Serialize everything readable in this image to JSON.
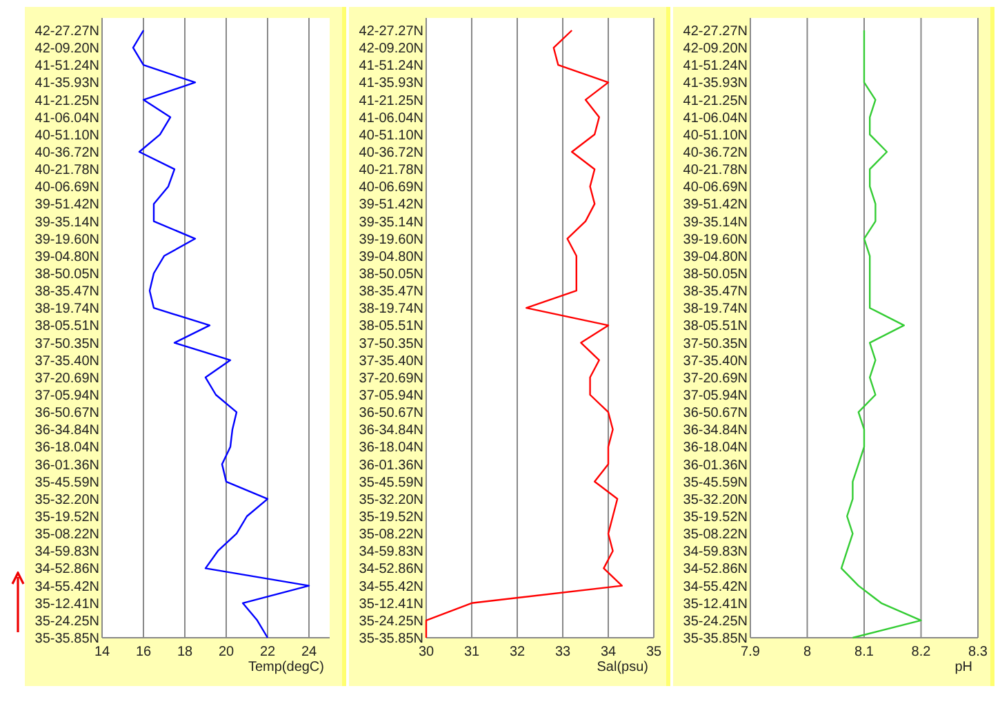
{
  "charts": [
    {
      "chart_data": {
        "type": "line",
        "orientation": "horizontal",
        "xlabel": "Temp(degC)",
        "categories": [
          "42-27.27N",
          "42-09.20N",
          "41-51.24N",
          "41-35.93N",
          "41-21.25N",
          "41-06.04N",
          "40-51.10N",
          "40-36.72N",
          "40-21.78N",
          "40-06.69N",
          "39-51.42N",
          "39-35.14N",
          "39-19.60N",
          "39-04.80N",
          "38-50.05N",
          "38-35.47N",
          "38-19.74N",
          "38-05.51N",
          "37-50.35N",
          "37-35.40N",
          "37-20.69N",
          "37-05.94N",
          "36-50.67N",
          "36-34.84N",
          "36-18.04N",
          "36-01.36N",
          "35-45.59N",
          "35-32.20N",
          "35-19.52N",
          "35-08.22N",
          "34-59.83N",
          "34-52.86N",
          "34-55.42N",
          "35-12.41N",
          "35-24.25N",
          "35-35.85N"
        ],
        "xlim": [
          14,
          25
        ],
        "xticks": [
          14,
          16,
          18,
          20,
          22,
          24
        ],
        "grid": true,
        "series": [
          {
            "color": "#0000ff",
            "values": [
              16,
              15.5,
              16,
              18.5,
              16,
              17.3,
              16.8,
              15.8,
              17.5,
              17.2,
              16.5,
              16.5,
              18.5,
              17,
              16.5,
              16.3,
              16.5,
              19.2,
              17.5,
              20.2,
              19,
              19.5,
              20.5,
              20.3,
              20.2,
              19.8,
              20,
              22,
              21,
              20.5,
              19.6,
              19,
              24,
              20.8,
              21.5,
              22
            ]
          }
        ]
      }
    },
    {
      "chart_data": {
        "type": "line",
        "orientation": "horizontal",
        "xlabel": "Sal(psu)",
        "categories": [
          "42-27.27N",
          "42-09.20N",
          "41-51.24N",
          "41-35.93N",
          "41-21.25N",
          "41-06.04N",
          "40-51.10N",
          "40-36.72N",
          "40-21.78N",
          "40-06.69N",
          "39-51.42N",
          "39-35.14N",
          "39-19.60N",
          "39-04.80N",
          "38-50.05N",
          "38-35.47N",
          "38-19.74N",
          "38-05.51N",
          "37-50.35N",
          "37-35.40N",
          "37-20.69N",
          "37-05.94N",
          "36-50.67N",
          "36-34.84N",
          "36-18.04N",
          "36-01.36N",
          "35-45.59N",
          "35-32.20N",
          "35-19.52N",
          "35-08.22N",
          "34-59.83N",
          "34-52.86N",
          "34-55.42N",
          "35-12.41N",
          "35-24.25N",
          "35-35.85N"
        ],
        "xlim": [
          30,
          35
        ],
        "xticks": [
          30,
          31,
          32,
          33,
          34,
          35
        ],
        "grid": true,
        "series": [
          {
            "color": "#ff0000",
            "values": [
              33.2,
              32.8,
              32.9,
              34.0,
              33.5,
              33.8,
              33.7,
              33.2,
              33.7,
              33.6,
              33.7,
              33.5,
              33.1,
              33.3,
              33.3,
              33.3,
              32.2,
              34.0,
              33.4,
              33.8,
              33.6,
              33.6,
              34.0,
              34.1,
              34.0,
              34.0,
              33.7,
              34.2,
              34.1,
              34.0,
              34.1,
              33.9,
              34.3,
              31.0,
              30.0,
              30.0
            ]
          }
        ]
      }
    },
    {
      "chart_data": {
        "type": "line",
        "orientation": "horizontal",
        "xlabel": "pH",
        "categories": [
          "42-27.27N",
          "42-09.20N",
          "41-51.24N",
          "41-35.93N",
          "41-21.25N",
          "41-06.04N",
          "40-51.10N",
          "40-36.72N",
          "40-21.78N",
          "40-06.69N",
          "39-51.42N",
          "39-35.14N",
          "39-19.60N",
          "39-04.80N",
          "38-50.05N",
          "38-35.47N",
          "38-19.74N",
          "38-05.51N",
          "37-50.35N",
          "37-35.40N",
          "37-20.69N",
          "37-05.94N",
          "36-50.67N",
          "36-34.84N",
          "36-18.04N",
          "36-01.36N",
          "35-45.59N",
          "35-32.20N",
          "35-19.52N",
          "35-08.22N",
          "34-59.83N",
          "34-52.86N",
          "34-55.42N",
          "35-12.41N",
          "35-24.25N",
          "35-35.85N"
        ],
        "xlim": [
          7.9,
          8.3
        ],
        "xticks": [
          7.9,
          8,
          8.1,
          8.2,
          8.3
        ],
        "grid": true,
        "series": [
          {
            "color": "#33cc33",
            "values": [
              8.1,
              8.1,
              8.1,
              8.1,
              8.12,
              8.11,
              8.11,
              8.14,
              8.11,
              8.11,
              8.12,
              8.12,
              8.1,
              8.11,
              8.11,
              8.11,
              8.11,
              8.17,
              8.11,
              8.12,
              8.11,
              8.12,
              8.09,
              8.1,
              8.1,
              8.09,
              8.08,
              8.08,
              8.07,
              8.08,
              8.07,
              8.06,
              8.09,
              8.13,
              8.2,
              8.08
            ]
          }
        ]
      }
    }
  ]
}
